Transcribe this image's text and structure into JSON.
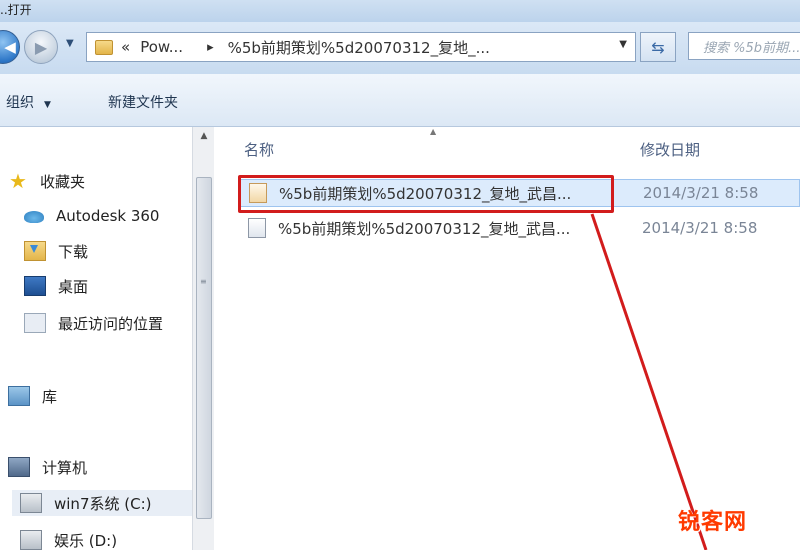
{
  "window": {
    "title": "..打开"
  },
  "address": {
    "crumb_prefix": "«",
    "crumb_parent": "Pow...",
    "crumb_sep": "▸",
    "crumb_current": "%5b前期策划%5d20070312_复地_..."
  },
  "search": {
    "placeholder": "搜索 %5b前期..."
  },
  "commands": {
    "organize": "组织",
    "new_folder": "新建文件夹"
  },
  "nav": {
    "favorites": "收藏夹",
    "items": [
      {
        "label": "Autodesk 360",
        "icon": "cloud-icon"
      },
      {
        "label": "下载",
        "icon": "download-folder-icon"
      },
      {
        "label": "桌面",
        "icon": "desktop-icon"
      },
      {
        "label": "最近访问的位置",
        "icon": "recent-places-icon"
      }
    ],
    "libraries": "库",
    "computer": "计算机",
    "drives": [
      {
        "label": "win7系统 (C:)",
        "icon": "drive-icon"
      },
      {
        "label": "娱乐 (D:)",
        "icon": "drive-icon"
      }
    ]
  },
  "files": {
    "columns": {
      "name": "名称",
      "date": "修改日期"
    },
    "rows": [
      {
        "name": "%5b前期策划%5d20070312_复地_武昌...",
        "date": "2014/3/21 8:58",
        "selected": true
      },
      {
        "name": "%5b前期策划%5d20070312_复地_武昌...",
        "date": "2014/3/21 8:58",
        "selected": false
      }
    ]
  },
  "annotation": {
    "color": "#d21c1c"
  },
  "watermark": {
    "text": "锐客网"
  }
}
